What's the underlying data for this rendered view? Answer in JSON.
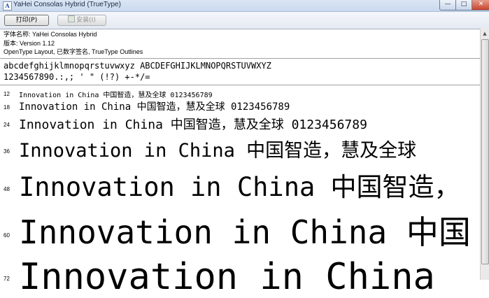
{
  "window": {
    "title": "YaHei Consolas Hybrid (TrueType)",
    "app_icon": "font-file-icon",
    "min_glyph": "—",
    "max_glyph": "□",
    "close_glyph": "✕"
  },
  "toolbar": {
    "print_label": "打印(P)",
    "install_label": "安装(I)",
    "install_enabled": false
  },
  "info": {
    "font_name_line": "字体名称: YaHei Consolas Hybrid",
    "version_line": "版本: Version 1.12",
    "type_line": "OpenType Layout, 已数字签名, TrueType Outlines"
  },
  "charset": {
    "line1": "abcdefghijklmnopqrstuvwxyz ABCDEFGHIJKLMNOPQRSTUVWXYZ",
    "line2": "1234567890.:,; ' \" (!?) +-*/="
  },
  "samples": [
    {
      "size": "12",
      "text": "Innovation in China 中国智造，慧及全球 0123456789"
    },
    {
      "size": "18",
      "text": "Innovation in China 中国智造，慧及全球 0123456789"
    },
    {
      "size": "24",
      "text": "Innovation in China 中国智造，慧及全球 0123456789"
    },
    {
      "size": "36",
      "text": "Innovation in China 中国智造，慧及全球"
    },
    {
      "size": "48",
      "text": "Innovation in China 中国智造，"
    },
    {
      "size": "60",
      "text": "Innovation in China 中国"
    },
    {
      "size": "72",
      "text": "Innovation in China"
    }
  ],
  "colors": {
    "titlebar": "#c9d9ee",
    "close_button": "#c8442c",
    "text": "#000000"
  }
}
